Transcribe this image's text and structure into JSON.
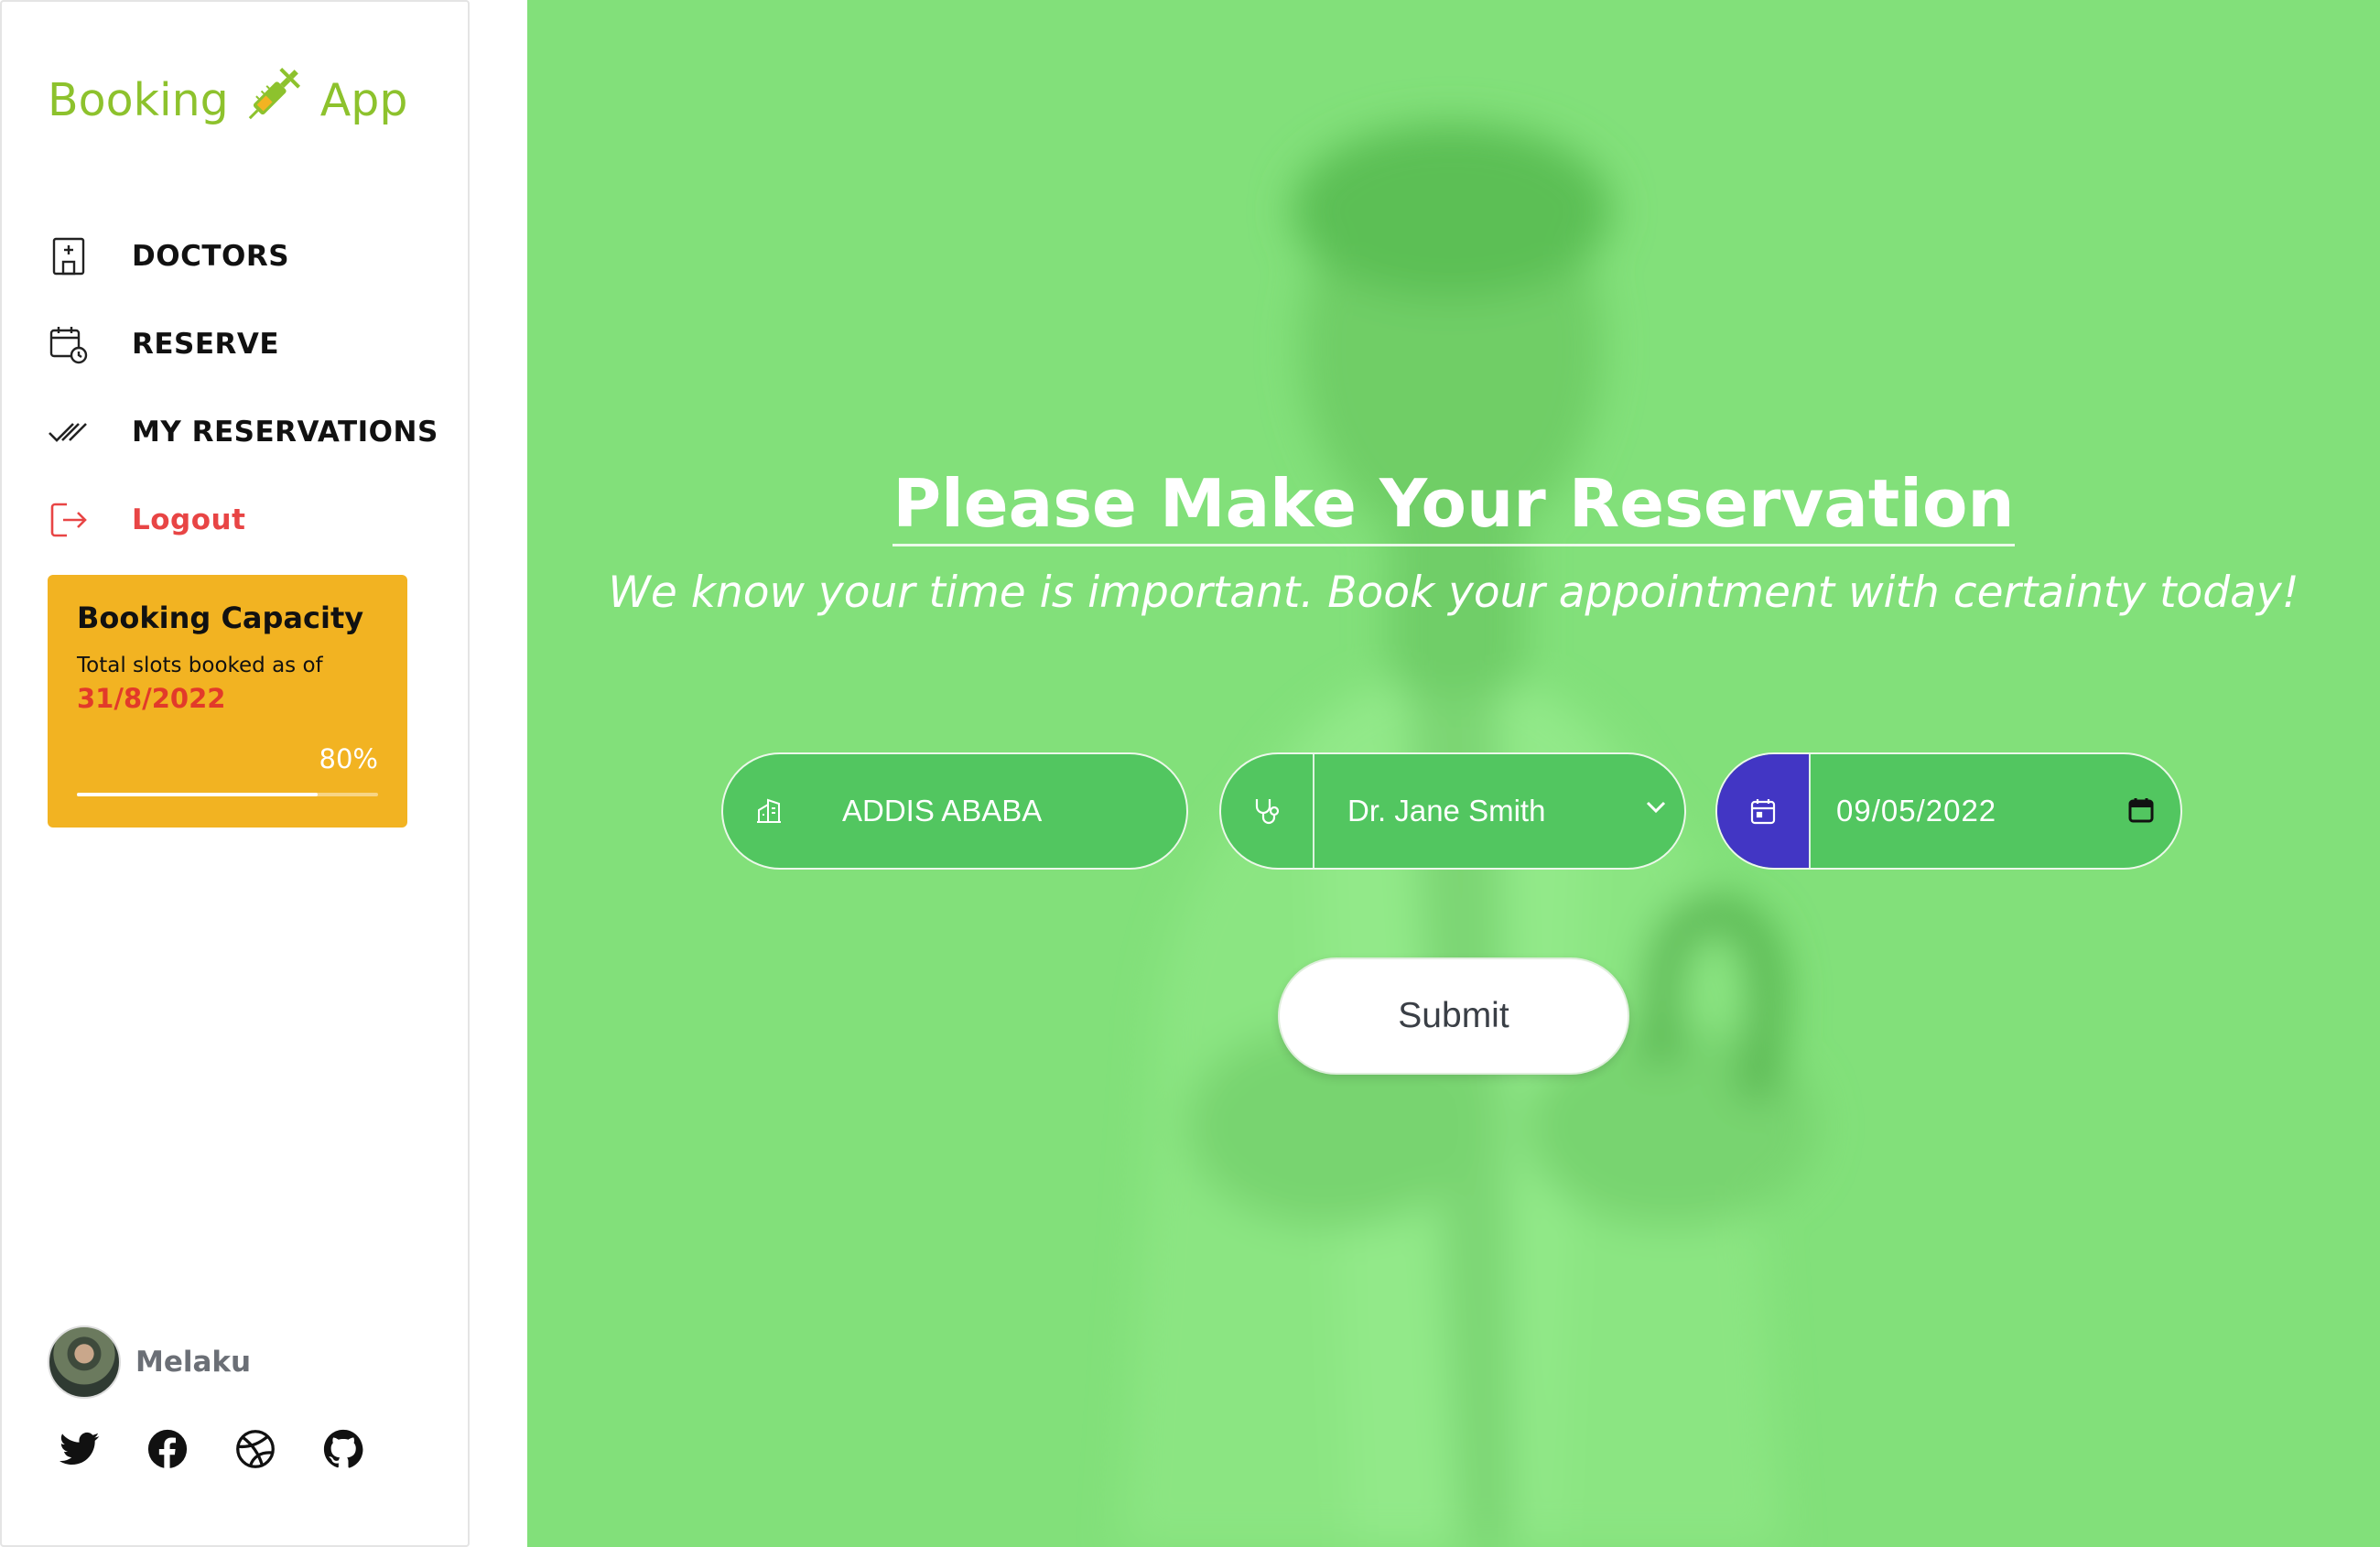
{
  "brand": {
    "part1": "Booking",
    "part2": "App",
    "icon": "syringe-icon"
  },
  "nav": [
    {
      "label": "DOCTORS",
      "icon": "hospital-icon"
    },
    {
      "label": "RESERVE",
      "icon": "calendar-clock-icon"
    },
    {
      "label": "MY RESERVATIONS",
      "icon": "double-check-icon"
    },
    {
      "label": "Logout",
      "icon": "logout-icon"
    }
  ],
  "capacity": {
    "title": "Booking Capacity",
    "subtitle": "Total slots booked as of",
    "date": "31/8/2022",
    "percent_label": "80%",
    "percent": 0.8
  },
  "user": {
    "name": "Melaku"
  },
  "social": [
    "twitter-icon",
    "facebook-icon",
    "dribbble-icon",
    "github-icon"
  ],
  "hero": {
    "title": "Please Make Your Reservation",
    "subtitle": "We know your time is important. Book your appointment with certainty today!"
  },
  "form": {
    "city": "ADDIS ABABA",
    "doctor": "Dr. Jane Smith",
    "date": "09/05/2022",
    "submit_label": "Submit"
  },
  "colors": {
    "accent_green": "#8dc22d",
    "background_green": "#82e07a",
    "field_green": "#52c660",
    "date_icon_blue": "#4236c4",
    "capacity_yellow": "#f2b322",
    "logout_red": "#e84545"
  }
}
